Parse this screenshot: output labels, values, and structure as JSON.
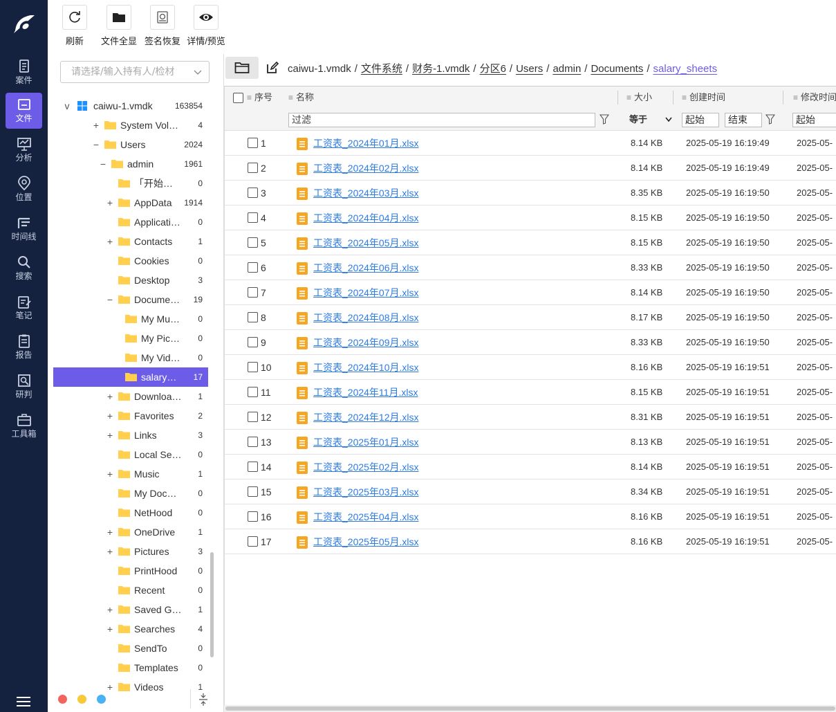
{
  "nav": {
    "items": [
      {
        "label": "案件",
        "icon": "case-icon"
      },
      {
        "label": "文件",
        "icon": "file-icon",
        "active": true
      },
      {
        "label": "分析",
        "icon": "analysis-icon"
      },
      {
        "label": "位置",
        "icon": "location-icon"
      },
      {
        "label": "时间线",
        "icon": "timeline-icon"
      },
      {
        "label": "搜索",
        "icon": "search-icon"
      },
      {
        "label": "笔记",
        "icon": "notes-icon"
      },
      {
        "label": "报告",
        "icon": "report-icon"
      },
      {
        "label": "研判",
        "icon": "research-icon"
      },
      {
        "label": "工具箱",
        "icon": "toolbox-icon"
      }
    ]
  },
  "toolbar": {
    "refresh": "刷新",
    "show_all_files": "文件全显",
    "signature_recovery": "签名恢复",
    "details_preview": "详情/预览"
  },
  "tree": {
    "holder_placeholder": "请选择/输入持有人/检材",
    "rows": [
      {
        "name": "caiwu-1.vmdk",
        "count": "163854",
        "toggle": "v"
      },
      {
        "name": "System Volume ...",
        "count": "4",
        "toggle": "+"
      },
      {
        "name": "Users",
        "count": "2024",
        "toggle": "−"
      },
      {
        "name": "admin",
        "count": "1961",
        "toggle": "−"
      },
      {
        "name": "「开始」菜单",
        "count": "0",
        "toggle": ""
      },
      {
        "name": "AppData",
        "count": "1914",
        "toggle": "+"
      },
      {
        "name": "Application ...",
        "count": "0",
        "toggle": ""
      },
      {
        "name": "Contacts",
        "count": "1",
        "toggle": "+"
      },
      {
        "name": "Cookies",
        "count": "0",
        "toggle": ""
      },
      {
        "name": "Desktop",
        "count": "3",
        "toggle": ""
      },
      {
        "name": "Documents",
        "count": "19",
        "toggle": "−"
      },
      {
        "name": "My Music",
        "count": "0",
        "toggle": ""
      },
      {
        "name": "My Pictures",
        "count": "0",
        "toggle": ""
      },
      {
        "name": "My Videos",
        "count": "0",
        "toggle": ""
      },
      {
        "name": "salary_she...",
        "count": "17",
        "toggle": "",
        "selected": true
      },
      {
        "name": "Downloads",
        "count": "1",
        "toggle": "+"
      },
      {
        "name": "Favorites",
        "count": "2",
        "toggle": "+"
      },
      {
        "name": "Links",
        "count": "3",
        "toggle": "+"
      },
      {
        "name": "Local Settings",
        "count": "0",
        "toggle": ""
      },
      {
        "name": "Music",
        "count": "1",
        "toggle": "+"
      },
      {
        "name": "My Documen...",
        "count": "0",
        "toggle": ""
      },
      {
        "name": "NetHood",
        "count": "0",
        "toggle": ""
      },
      {
        "name": "OneDrive",
        "count": "1",
        "toggle": "+"
      },
      {
        "name": "Pictures",
        "count": "3",
        "toggle": "+"
      },
      {
        "name": "PrintHood",
        "count": "0",
        "toggle": ""
      },
      {
        "name": "Recent",
        "count": "0",
        "toggle": ""
      },
      {
        "name": "Saved Games",
        "count": "1",
        "toggle": "+"
      },
      {
        "name": "Searches",
        "count": "4",
        "toggle": "+"
      },
      {
        "name": "SendTo",
        "count": "0",
        "toggle": ""
      },
      {
        "name": "Templates",
        "count": "0",
        "toggle": ""
      },
      {
        "name": "Videos",
        "count": "1",
        "toggle": "+"
      }
    ]
  },
  "breadcrumb": [
    "caiwu-1.vmdk",
    "文件系统",
    "财务-1.vmdk",
    "分区6",
    "Users",
    "admin",
    "Documents",
    "salary_sheets"
  ],
  "table": {
    "headers": {
      "index": "序号",
      "name": "名称",
      "size": "大小",
      "created": "创建时间",
      "modified": "修改时间"
    },
    "filter": {
      "name_placeholder": "过滤",
      "size_op": "等于",
      "created_start": "起始",
      "created_end": "结束",
      "modified_start": "起始"
    },
    "rows": [
      {
        "idx": "1",
        "name": "工资表_2024年01月.xlsx",
        "size": "8.14 KB",
        "created": "2025-05-19 16:19:49",
        "modified": "2025-05-"
      },
      {
        "idx": "2",
        "name": "工资表_2024年02月.xlsx",
        "size": "8.14 KB",
        "created": "2025-05-19 16:19:49",
        "modified": "2025-05-"
      },
      {
        "idx": "3",
        "name": "工资表_2024年03月.xlsx",
        "size": "8.35 KB",
        "created": "2025-05-19 16:19:50",
        "modified": "2025-05-"
      },
      {
        "idx": "4",
        "name": "工资表_2024年04月.xlsx",
        "size": "8.15 KB",
        "created": "2025-05-19 16:19:50",
        "modified": "2025-05-"
      },
      {
        "idx": "5",
        "name": "工资表_2024年05月.xlsx",
        "size": "8.15 KB",
        "created": "2025-05-19 16:19:50",
        "modified": "2025-05-"
      },
      {
        "idx": "6",
        "name": "工资表_2024年06月.xlsx",
        "size": "8.33 KB",
        "created": "2025-05-19 16:19:50",
        "modified": "2025-05-"
      },
      {
        "idx": "7",
        "name": "工资表_2024年07月.xlsx",
        "size": "8.14 KB",
        "created": "2025-05-19 16:19:50",
        "modified": "2025-05-"
      },
      {
        "idx": "8",
        "name": "工资表_2024年08月.xlsx",
        "size": "8.17 KB",
        "created": "2025-05-19 16:19:50",
        "modified": "2025-05-"
      },
      {
        "idx": "9",
        "name": "工资表_2024年09月.xlsx",
        "size": "8.33 KB",
        "created": "2025-05-19 16:19:50",
        "modified": "2025-05-"
      },
      {
        "idx": "10",
        "name": "工资表_2024年10月.xlsx",
        "size": "8.16 KB",
        "created": "2025-05-19 16:19:51",
        "modified": "2025-05-"
      },
      {
        "idx": "11",
        "name": "工资表_2024年11月.xlsx",
        "size": "8.15 KB",
        "created": "2025-05-19 16:19:51",
        "modified": "2025-05-"
      },
      {
        "idx": "12",
        "name": "工资表_2024年12月.xlsx",
        "size": "8.31 KB",
        "created": "2025-05-19 16:19:51",
        "modified": "2025-05-"
      },
      {
        "idx": "13",
        "name": "工资表_2025年01月.xlsx",
        "size": "8.13 KB",
        "created": "2025-05-19 16:19:51",
        "modified": "2025-05-"
      },
      {
        "idx": "14",
        "name": "工资表_2025年02月.xlsx",
        "size": "8.14 KB",
        "created": "2025-05-19 16:19:51",
        "modified": "2025-05-"
      },
      {
        "idx": "15",
        "name": "工资表_2025年03月.xlsx",
        "size": "8.34 KB",
        "created": "2025-05-19 16:19:51",
        "modified": "2025-05-"
      },
      {
        "idx": "16",
        "name": "工资表_2025年04月.xlsx",
        "size": "8.16 KB",
        "created": "2025-05-19 16:19:51",
        "modified": "2025-05-"
      },
      {
        "idx": "17",
        "name": "工资表_2025年05月.xlsx",
        "size": "8.16 KB",
        "created": "2025-05-19 16:19:51",
        "modified": "2025-05-"
      }
    ]
  },
  "colors": {
    "nav_bg": "#14213f",
    "accent": "#6c5ce7",
    "link": "#2c7be5",
    "folder": "#ffcf4d",
    "xlsx_icon": "#f5a623"
  }
}
